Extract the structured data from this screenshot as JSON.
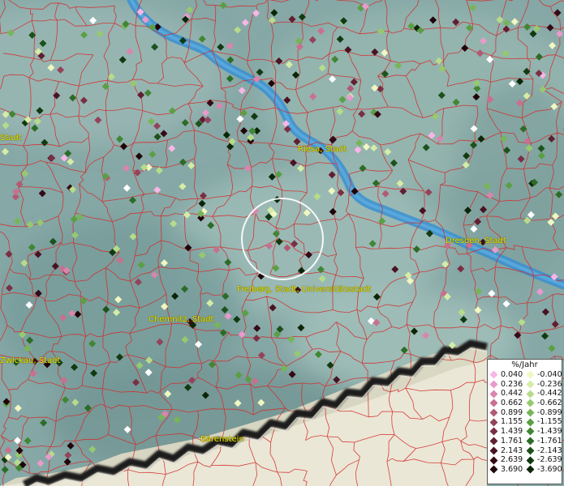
{
  "cities": [
    {
      "name": "Riesa, Stadt",
      "id": "riesa"
    },
    {
      "name": "Dresden, Stadt",
      "id": "dresden"
    },
    {
      "name": "Freiberg, Stadt, Universitätsstadt",
      "id": "freiberg"
    },
    {
      "name": "Chemnitz, Stadt",
      "id": "chemnitz"
    },
    {
      "name": "Zwickau, Stadt",
      "id": "zwickau"
    },
    {
      "name": "Bärenstein",
      "id": "baerenstein"
    },
    {
      "name": "Stadt",
      "id": "edge-west"
    }
  ],
  "legend": {
    "title": "%/Jahr",
    "positive": [
      "0.040",
      "0.236",
      "0.442",
      "0.662",
      "0.899",
      "1.155",
      "1.439",
      "1.761",
      "2.143",
      "2.639",
      "3.690"
    ],
    "negative": [
      "-0.040",
      "-0.236",
      "-0.442",
      "-0.662",
      "-0.899",
      "-1.155",
      "-1.439",
      "-1.761",
      "-2.143",
      "-2.639",
      "-3.690"
    ],
    "positive_colors": [
      "#f7b6e6",
      "#e89acb",
      "#d985ad",
      "#c8708f",
      "#b05a74",
      "#93435b",
      "#7a2f44",
      "#611f31",
      "#491323",
      "#340a17",
      "#200409"
    ],
    "negative_colors": [
      "#f0f7c0",
      "#d5eca6",
      "#b6dc8a",
      "#96c96f",
      "#76b558",
      "#5a9f44",
      "#418634",
      "#2c6c27",
      "#1c521b",
      "#113a11",
      "#0a2608"
    ]
  },
  "colors": {
    "border_lines": "#d42a2a",
    "river": "#3a8fd0",
    "label_text": "#e8e400",
    "uplift_white": "#ffffff"
  }
}
